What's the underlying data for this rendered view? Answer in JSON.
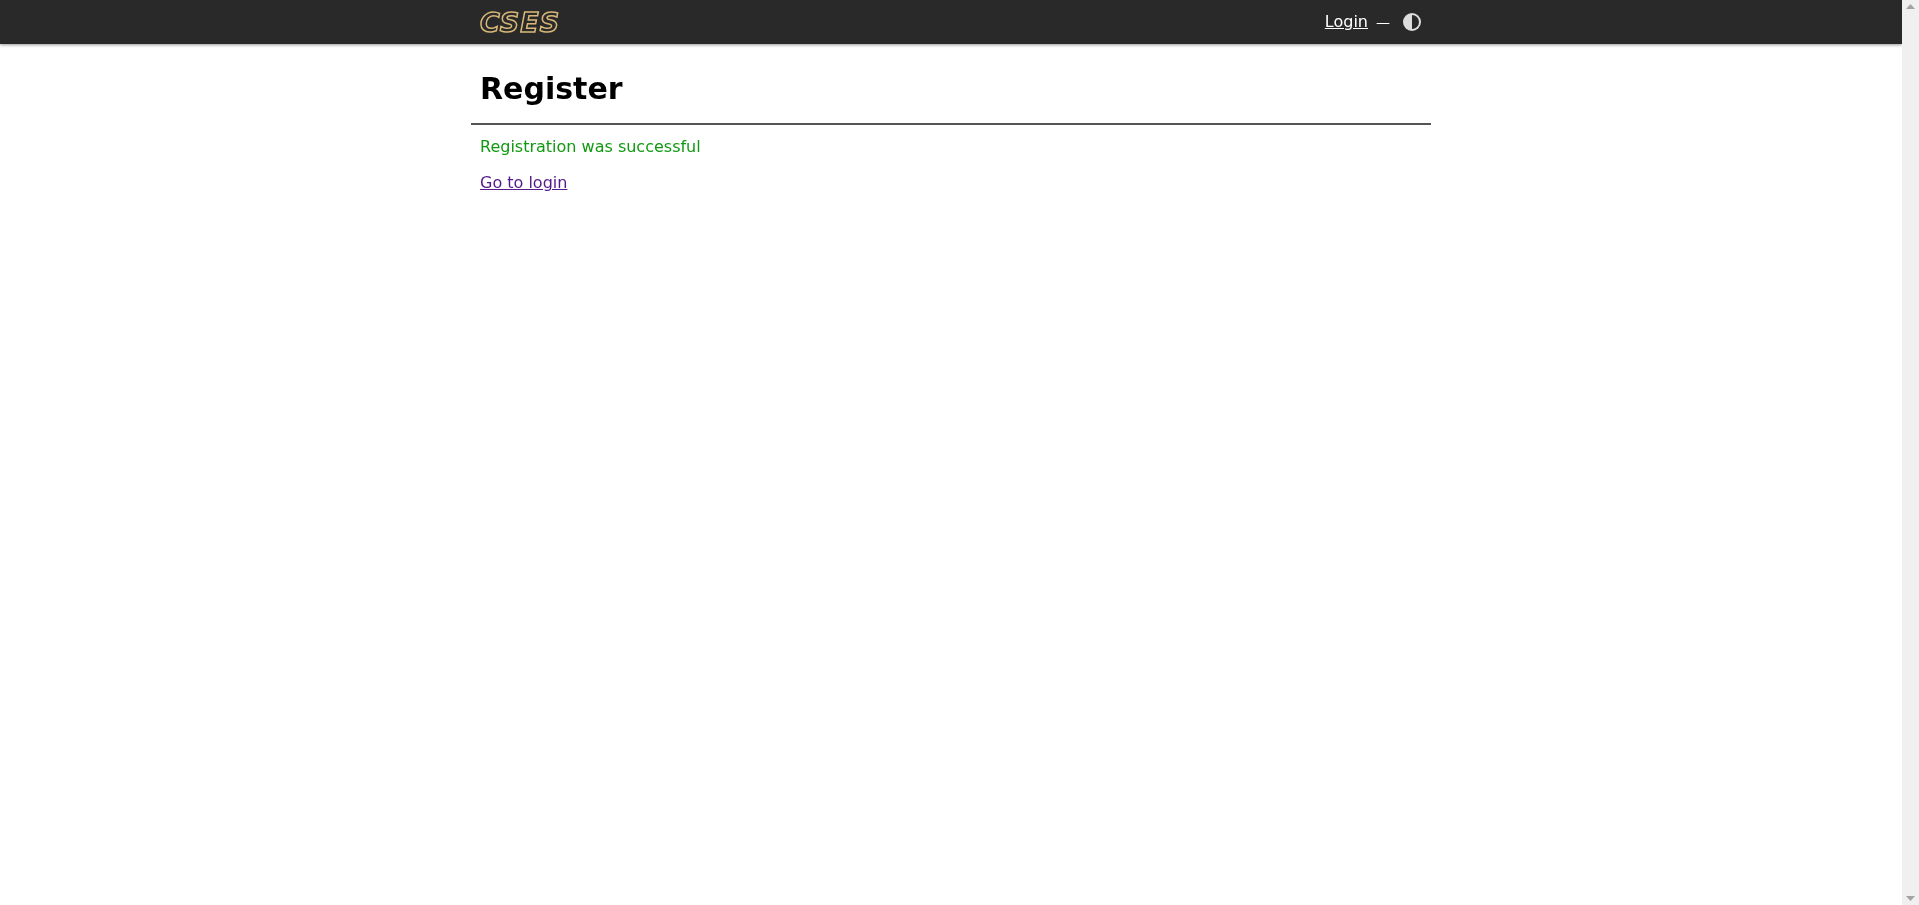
{
  "header": {
    "logo": "CSES",
    "login_link": "Login",
    "separator": "—"
  },
  "page": {
    "title": "Register",
    "message": "Registration was successful",
    "link": "Go to login"
  }
}
